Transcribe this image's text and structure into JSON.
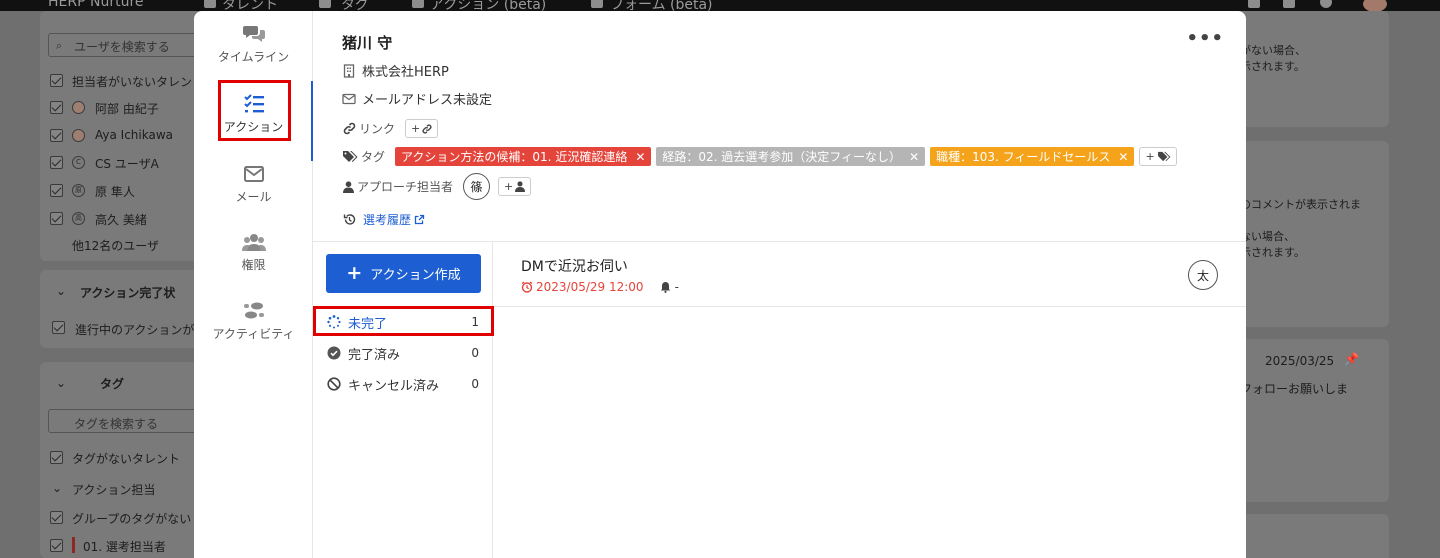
{
  "background": {
    "topbar": {
      "app_name": "HERP Nurture",
      "nav_1": "タレント",
      "nav_2": "タグ",
      "nav_3": "アクション (beta)",
      "nav_4": "フォーム (beta)"
    },
    "left": {
      "user_search_placeholder": "ユーザを検索する",
      "user_items": [
        "担当者がいないタレント",
        "阿部 由紀子",
        "Aya Ichikawa",
        "CS ユーザA",
        "原 隼人",
        "高久 美緒"
      ],
      "user_avatars": [
        "",
        "",
        "",
        "C",
        "原",
        "高"
      ],
      "more_users": "他12名のユーザ",
      "action_section_title": "アクション完了状",
      "action_item": "進行中のアクションが",
      "tag_section_title": "タグ",
      "tag_search_placeholder": "タグを検索する",
      "tag_items": [
        "タグがないタレント"
      ],
      "tag_group_title": "アクション担当",
      "tag_group_items": [
        "グループのタグがない",
        "01. 選考担当者"
      ]
    },
    "right": {
      "text_1": "がない場合、",
      "text_2": "示されます。",
      "text_3": "のコメントが表示されま",
      "text_4": "ない場合、",
      "text_5": "示されます。",
      "date": "2025/03/25",
      "text_6": "フォローお願いしま"
    }
  },
  "modal": {
    "nav": [
      {
        "label": "タイムライン",
        "icon": "chat-bubbles-icon"
      },
      {
        "label": "アクション",
        "icon": "checklist-icon"
      },
      {
        "label": "メール",
        "icon": "envelope-icon"
      },
      {
        "label": "権限",
        "icon": "users-icon"
      },
      {
        "label": "アクティビティ",
        "icon": "footsteps-icon"
      }
    ],
    "candidate": {
      "name": "猪川 守",
      "company": "株式会社HERP",
      "email": "メールアドレス未設定",
      "link_label": "リンク",
      "link_add": "+",
      "tag_label": "タグ",
      "tags": [
        {
          "text": "アクション方法の候補：01. 近況確認連絡",
          "color": "#e5443b"
        },
        {
          "text": "経路：02. 過去選考参加（決定フィーなし）",
          "color": "#b5b5b5"
        },
        {
          "text": "職種：103. フィールドセールス",
          "color": "#f5a31a"
        }
      ],
      "tag_add": "+",
      "approach_label": "アプローチ担当者",
      "approach_avatar": "篠",
      "approach_add": "+",
      "history_link": "選考履歴",
      "more": "•••"
    },
    "create_button": "アクション作成",
    "statuses": [
      {
        "label": "未完了",
        "count": "1"
      },
      {
        "label": "完了済み",
        "count": "0"
      },
      {
        "label": "キャンセル済み",
        "count": "0"
      }
    ],
    "actions": [
      {
        "title": "DMで近況お伺い",
        "date": "2023/05/29 12:00",
        "notify": "-",
        "assignee": "太"
      }
    ]
  }
}
